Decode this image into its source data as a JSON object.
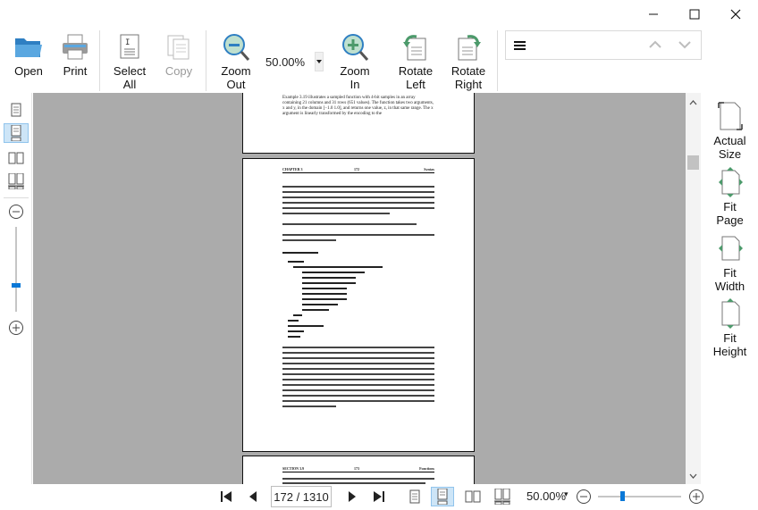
{
  "toolbar": {
    "open": "Open",
    "print": "Print",
    "select_all_1": "Select",
    "select_all_2": "All",
    "copy": "Copy",
    "zoom_out_1": "Zoom",
    "zoom_out_2": "Out",
    "zoom_value": "50.00%",
    "zoom_in_1": "Zoom",
    "zoom_in_2": "In",
    "rotate_left_1": "Rotate",
    "rotate_left_2": "Left",
    "rotate_right_1": "Rotate",
    "rotate_right_2": "Right"
  },
  "right_panel": {
    "actual_size_1": "Actual",
    "actual_size_2": "Size",
    "fit_page_1": "Fit",
    "fit_page_2": "Page",
    "fit_width_1": "Fit",
    "fit_width_2": "Width",
    "fit_height_1": "Fit",
    "fit_height_2": "Height"
  },
  "document": {
    "page1_text": "Example 3.19 illustrates a sampled function with 4-bit samples in an array containing 21 columns and 31 rows (651 values). The function takes two arguments, x and y, in the domain [−1.0 1.0], and returns one value, z, in that same range. The x argument is linearly transformed by the encoding to the",
    "page2_header_left": "CHAPTER 3",
    "page2_header_center": "172",
    "page2_header_right": "Syntax",
    "page3_header_left": "SECTION 3.9",
    "page3_header_center": "173",
    "page3_header_right": "Functions"
  },
  "status": {
    "page_indicator": "172 / 1310",
    "zoom_value": "50.00%",
    "zoom_dropdown": "▾"
  },
  "colors": {
    "accent": "#0a78d7",
    "active_bg": "#cde5f7",
    "viewport_bg": "#ababab",
    "icon_green": "#4c9a6b",
    "icon_blue": "#2f7fc2"
  }
}
